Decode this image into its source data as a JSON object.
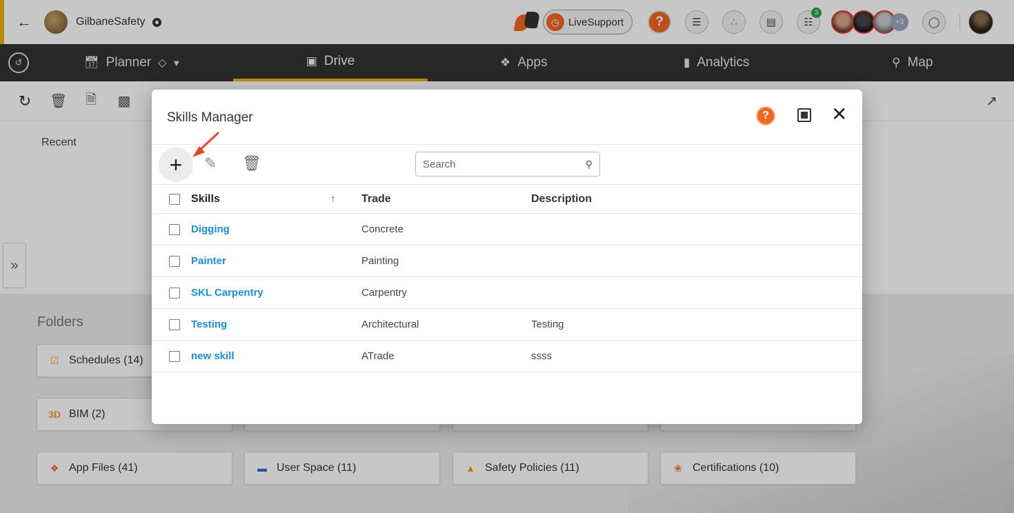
{
  "header": {
    "project_name": "GilbaneSafety",
    "live_support_label": "LiveSupport",
    "help_label": "?",
    "cart_badge": "3",
    "more_avatars": "+3"
  },
  "nav": {
    "items": [
      {
        "label": "Planner"
      },
      {
        "label": "Drive"
      },
      {
        "label": "Apps"
      },
      {
        "label": "Analytics"
      },
      {
        "label": "Map"
      }
    ]
  },
  "page": {
    "recent_label": "Recent",
    "folders_title": "Folders",
    "folders": [
      {
        "label": "Schedules (14)"
      },
      {
        "label": "BIM (2)"
      },
      {
        "label": "App Files (41)"
      },
      {
        "label": "User Space (11)"
      },
      {
        "label": "Safety Policies (11)"
      },
      {
        "label": "Certifications (10)"
      }
    ]
  },
  "modal": {
    "title": "Skills Manager",
    "help_label": "?",
    "search_placeholder": "Search",
    "columns": {
      "skills": "Skills",
      "trade": "Trade",
      "description": "Description"
    },
    "rows": [
      {
        "skill": "Digging",
        "trade": "Concrete",
        "description": ""
      },
      {
        "skill": "Painter",
        "trade": "Painting",
        "description": ""
      },
      {
        "skill": "SKL Carpentry",
        "trade": "Carpentry",
        "description": ""
      },
      {
        "skill": "Testing",
        "trade": "Architectural",
        "description": "Testing"
      },
      {
        "skill": "new skill",
        "trade": "ATrade",
        "description": "ssss"
      }
    ]
  },
  "colors": {
    "accent": "#f0b400",
    "brand_orange": "#f26722",
    "link": "#1a8fd1",
    "nav_bg": "#333333"
  }
}
